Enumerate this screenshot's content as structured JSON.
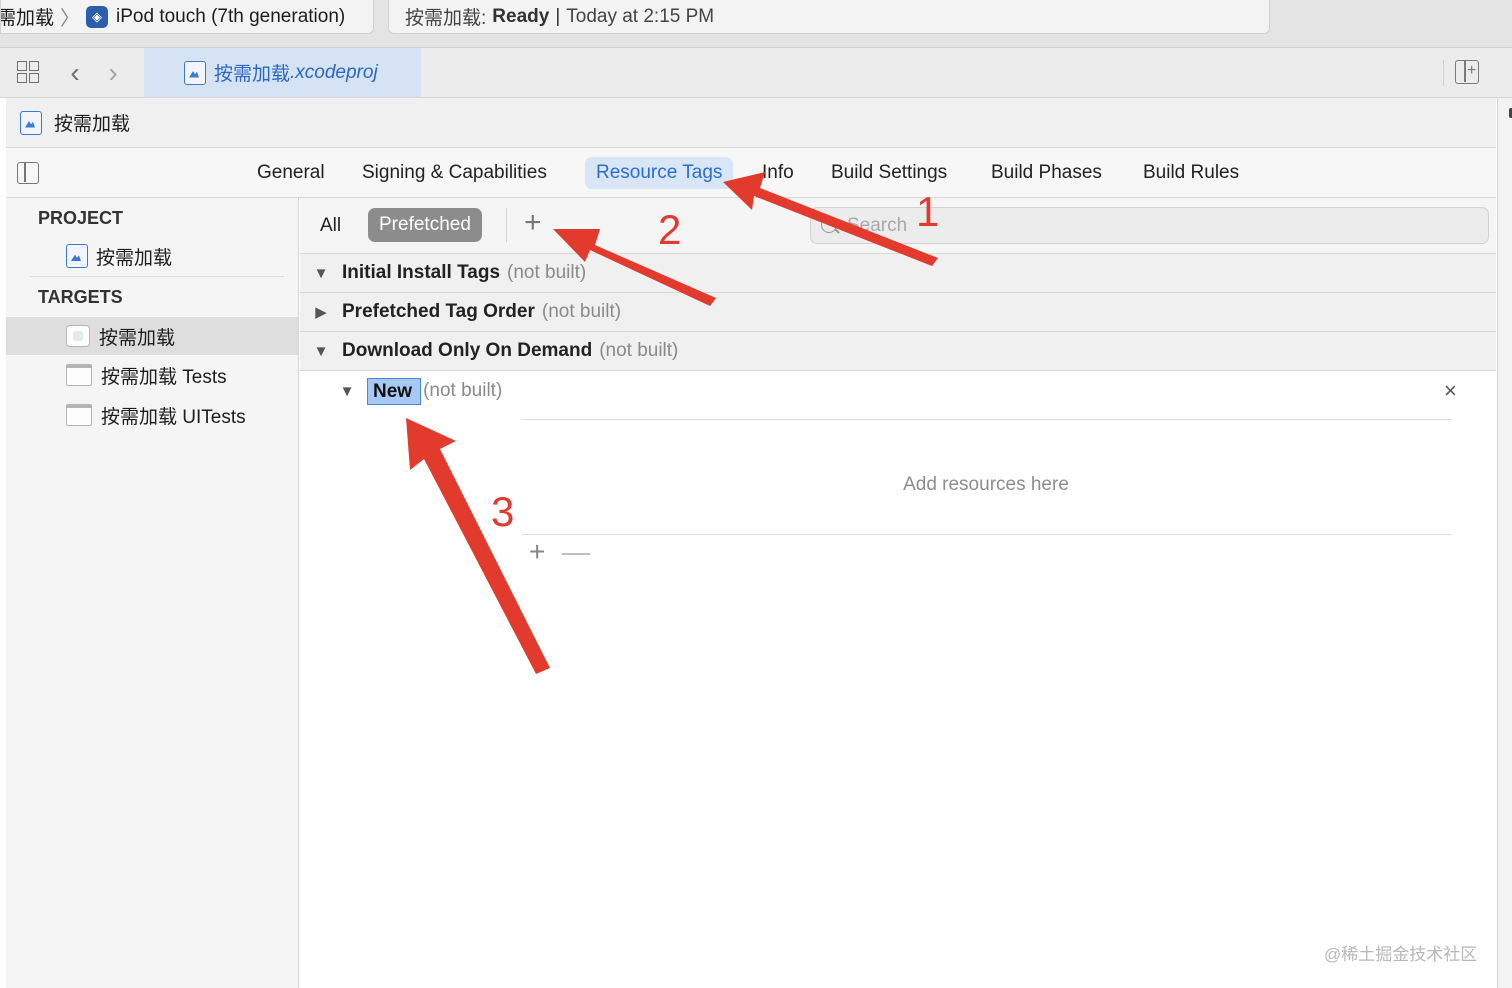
{
  "scheme": {
    "project": "需加载",
    "device": "iPod touch (7th generation)"
  },
  "status": {
    "project": "按需加载:",
    "state": "Ready",
    "separator": "|",
    "time": "Today at 2:15 PM"
  },
  "tabbar": {
    "file_name": "按需加载",
    "file_ext": ".xcodeproj"
  },
  "project_header": {
    "title": "按需加载"
  },
  "editor_tabs": [
    {
      "label": "General"
    },
    {
      "label": "Signing & Capabilities"
    },
    {
      "label": "Resource Tags",
      "active": true
    },
    {
      "label": "Info"
    },
    {
      "label": "Build Settings"
    },
    {
      "label": "Build Phases"
    },
    {
      "label": "Build Rules"
    }
  ],
  "navigator": {
    "project_heading": "PROJECT",
    "project_item": "按需加载",
    "targets_heading": "TARGETS",
    "targets": [
      {
        "label": "按需加载",
        "selected": true
      },
      {
        "label": "按需加载 Tests"
      },
      {
        "label": "按需加载 UITests"
      }
    ]
  },
  "filter": {
    "all_label": "All",
    "prefetched_label": "Prefetched",
    "add_label": "+",
    "search_placeholder": "Search"
  },
  "sections": [
    {
      "title": "Initial Install Tags",
      "note": "(not built)",
      "expanded": true
    },
    {
      "title": "Prefetched Tag Order",
      "note": "(not built)",
      "expanded": false
    },
    {
      "title": "Download Only On Demand",
      "note": "(not built)",
      "expanded": true
    }
  ],
  "tag": {
    "name": "New",
    "note": "(not built)",
    "close": "×",
    "placeholder": "Add resources here",
    "add": "+",
    "remove": "—"
  },
  "annotations": [
    "1",
    "2",
    "3"
  ],
  "watermark": "@稀土掘金技术社区",
  "colors": {
    "accent": "#2a6dd6",
    "annotation": "#e23b2e",
    "selection": "#a9c9f5"
  }
}
